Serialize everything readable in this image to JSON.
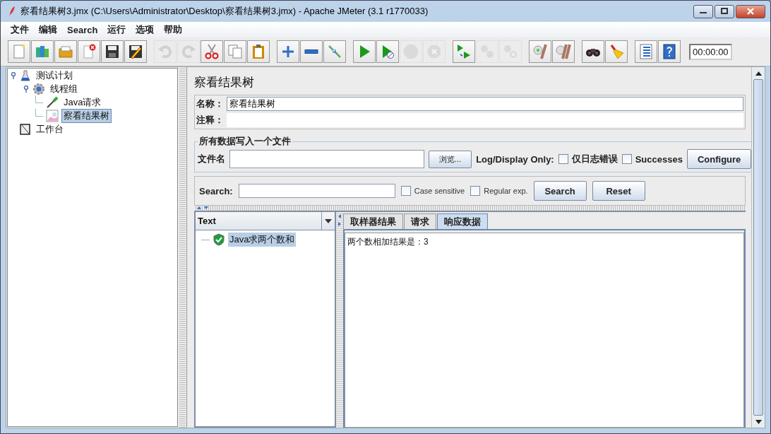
{
  "window": {
    "title": "察看结果树3.jmx (C:\\Users\\Administrator\\Desktop\\察看结果树3.jmx) - Apache JMeter (3.1 r1770033)"
  },
  "menu": [
    "文件",
    "编辑",
    "Search",
    "运行",
    "选项",
    "帮助"
  ],
  "toolbar": {
    "groups": [
      [
        {
          "disabled": false
        },
        {
          "disabled": false
        },
        {
          "disabled": false
        },
        {
          "disabled": false
        },
        {
          "disabled": false
        },
        {
          "disabled": false
        }
      ],
      [
        {
          "disabled": true
        },
        {
          "disabled": true
        },
        {
          "disabled": false
        },
        {
          "disabled": false
        },
        {
          "disabled": false
        }
      ],
      [
        {
          "disabled": false
        },
        {
          "disabled": false
        },
        {
          "disabled": false
        }
      ],
      [
        {
          "disabled": false
        },
        {
          "disabled": false
        },
        {
          "disabled": true
        },
        {
          "disabled": true
        }
      ],
      [
        {
          "disabled": false
        },
        {
          "disabled": true
        },
        {
          "disabled": true
        }
      ],
      [
        {
          "disabled": false
        },
        {
          "disabled": false
        }
      ],
      [
        {
          "disabled": false
        },
        {
          "disabled": false
        }
      ],
      [
        {
          "disabled": false
        },
        {
          "disabled": false
        }
      ]
    ],
    "timer": "00:00:00"
  },
  "tree": [
    {
      "label": "测试计划",
      "selected": false,
      "children": [
        {
          "label": "线程组",
          "selected": false,
          "children": [
            {
              "label": "Java请求",
              "selected": false
            },
            {
              "label": "察看结果树",
              "selected": true
            }
          ]
        }
      ]
    },
    {
      "label": "工作台",
      "selected": false
    }
  ],
  "panel": {
    "title": "察看结果树",
    "name_label": "名称：",
    "name_value": "察看结果树",
    "comment_label": "注释：",
    "file_group": {
      "legend": "所有数据写入一个文件",
      "file_label": "文件名",
      "browse": "浏览...",
      "log_label": "Log/Display Only:",
      "options": [
        {
          "label": "仅日志错误",
          "checked": false
        },
        {
          "label": "Successes",
          "checked": false
        }
      ],
      "configure": "Configure"
    },
    "search": {
      "label": "Search:",
      "options": [
        {
          "label": "Case sensitive",
          "checked": false
        },
        {
          "label": "Regular exp.",
          "checked": false
        }
      ],
      "buttons": [
        "Search",
        "Reset"
      ]
    },
    "renderer": "Text",
    "results": [
      {
        "label": "Java求两个数和",
        "selected": true
      }
    ],
    "tabs": [
      {
        "label": "取样器结果",
        "selected": false
      },
      {
        "label": "请求",
        "selected": false
      },
      {
        "label": "响应数据",
        "selected": true
      }
    ],
    "response": "两个数相加结果是：3"
  }
}
